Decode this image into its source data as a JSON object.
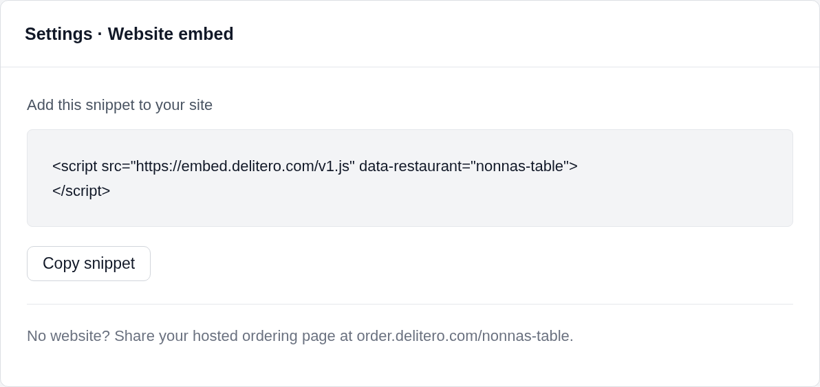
{
  "header": {
    "title": "Settings · Website embed"
  },
  "snippet": {
    "label": "Add this snippet to your site",
    "code": "<script src=\"https://embed.delitero.com/v1.js\" data-restaurant=\"nonnas-table\">\n</script>"
  },
  "buttons": [
    {
      "label": "Copy snippet"
    }
  ],
  "footer_note": "No website? Share your hosted ordering page at order.delitero.com/nonnas-table."
}
